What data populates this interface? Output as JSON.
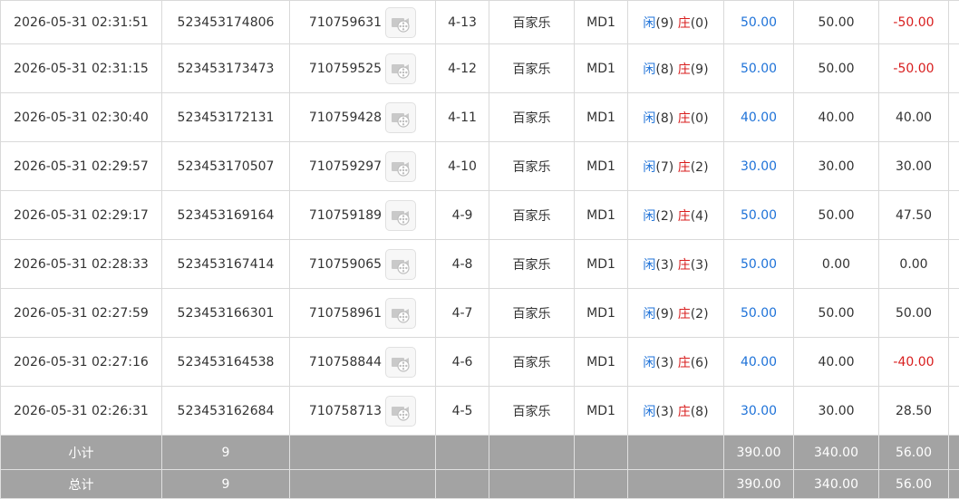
{
  "rows": [
    {
      "time": "2026-05-31 02:31:51",
      "bet_id": "523453174806",
      "round_id": "710759631",
      "shoe": "4-13",
      "game": "百家乐",
      "table": "MD1",
      "player_label": "闲",
      "player_val": "(9)",
      "banker_label": "庄",
      "banker_val": "(0)",
      "bet": "50.00",
      "valid": "50.00",
      "payout": "-50.00",
      "payout_neg": true
    },
    {
      "time": "2026-05-31 02:31:15",
      "bet_id": "523453173473",
      "round_id": "710759525",
      "shoe": "4-12",
      "game": "百家乐",
      "table": "MD1",
      "player_label": "闲",
      "player_val": "(8)",
      "banker_label": "庄",
      "banker_val": "(9)",
      "bet": "50.00",
      "valid": "50.00",
      "payout": "-50.00",
      "payout_neg": true
    },
    {
      "time": "2026-05-31 02:30:40",
      "bet_id": "523453172131",
      "round_id": "710759428",
      "shoe": "4-11",
      "game": "百家乐",
      "table": "MD1",
      "player_label": "闲",
      "player_val": "(8)",
      "banker_label": "庄",
      "banker_val": "(0)",
      "bet": "40.00",
      "valid": "40.00",
      "payout": "40.00",
      "payout_neg": false
    },
    {
      "time": "2026-05-31 02:29:57",
      "bet_id": "523453170507",
      "round_id": "710759297",
      "shoe": "4-10",
      "game": "百家乐",
      "table": "MD1",
      "player_label": "闲",
      "player_val": "(7)",
      "banker_label": "庄",
      "banker_val": "(2)",
      "bet": "30.00",
      "valid": "30.00",
      "payout": "30.00",
      "payout_neg": false
    },
    {
      "time": "2026-05-31 02:29:17",
      "bet_id": "523453169164",
      "round_id": "710759189",
      "shoe": "4-9",
      "game": "百家乐",
      "table": "MD1",
      "player_label": "闲",
      "player_val": "(2)",
      "banker_label": "庄",
      "banker_val": "(4)",
      "bet": "50.00",
      "valid": "50.00",
      "payout": "47.50",
      "payout_neg": false
    },
    {
      "time": "2026-05-31 02:28:33",
      "bet_id": "523453167414",
      "round_id": "710759065",
      "shoe": "4-8",
      "game": "百家乐",
      "table": "MD1",
      "player_label": "闲",
      "player_val": "(3)",
      "banker_label": "庄",
      "banker_val": "(3)",
      "bet": "50.00",
      "valid": "0.00",
      "payout": "0.00",
      "payout_neg": false
    },
    {
      "time": "2026-05-31 02:27:59",
      "bet_id": "523453166301",
      "round_id": "710758961",
      "shoe": "4-7",
      "game": "百家乐",
      "table": "MD1",
      "player_label": "闲",
      "player_val": "(9)",
      "banker_label": "庄",
      "banker_val": "(2)",
      "bet": "50.00",
      "valid": "50.00",
      "payout": "50.00",
      "payout_neg": false
    },
    {
      "time": "2026-05-31 02:27:16",
      "bet_id": "523453164538",
      "round_id": "710758844",
      "shoe": "4-6",
      "game": "百家乐",
      "table": "MD1",
      "player_label": "闲",
      "player_val": "(3)",
      "banker_label": "庄",
      "banker_val": "(6)",
      "bet": "40.00",
      "valid": "40.00",
      "payout": "-40.00",
      "payout_neg": true
    },
    {
      "time": "2026-05-31 02:26:31",
      "bet_id": "523453162684",
      "round_id": "710758713",
      "shoe": "4-5",
      "game": "百家乐",
      "table": "MD1",
      "player_label": "闲",
      "player_val": "(3)",
      "banker_label": "庄",
      "banker_val": "(8)",
      "bet": "30.00",
      "valid": "30.00",
      "payout": "28.50",
      "payout_neg": false
    }
  ],
  "subtotal": {
    "label": "小计",
    "count": "9",
    "bet": "390.00",
    "valid": "340.00",
    "payout": "56.00"
  },
  "total": {
    "label": "总计",
    "count": "9",
    "bet": "390.00",
    "valid": "340.00",
    "payout": "56.00"
  },
  "icons": {
    "video": "video-replay-icon"
  },
  "colors": {
    "player": "#1e72d8",
    "banker": "#d81e1e",
    "negative": "#d81e1e",
    "bet": "#1e72d8",
    "summary_bg": "#a3a3a3"
  }
}
